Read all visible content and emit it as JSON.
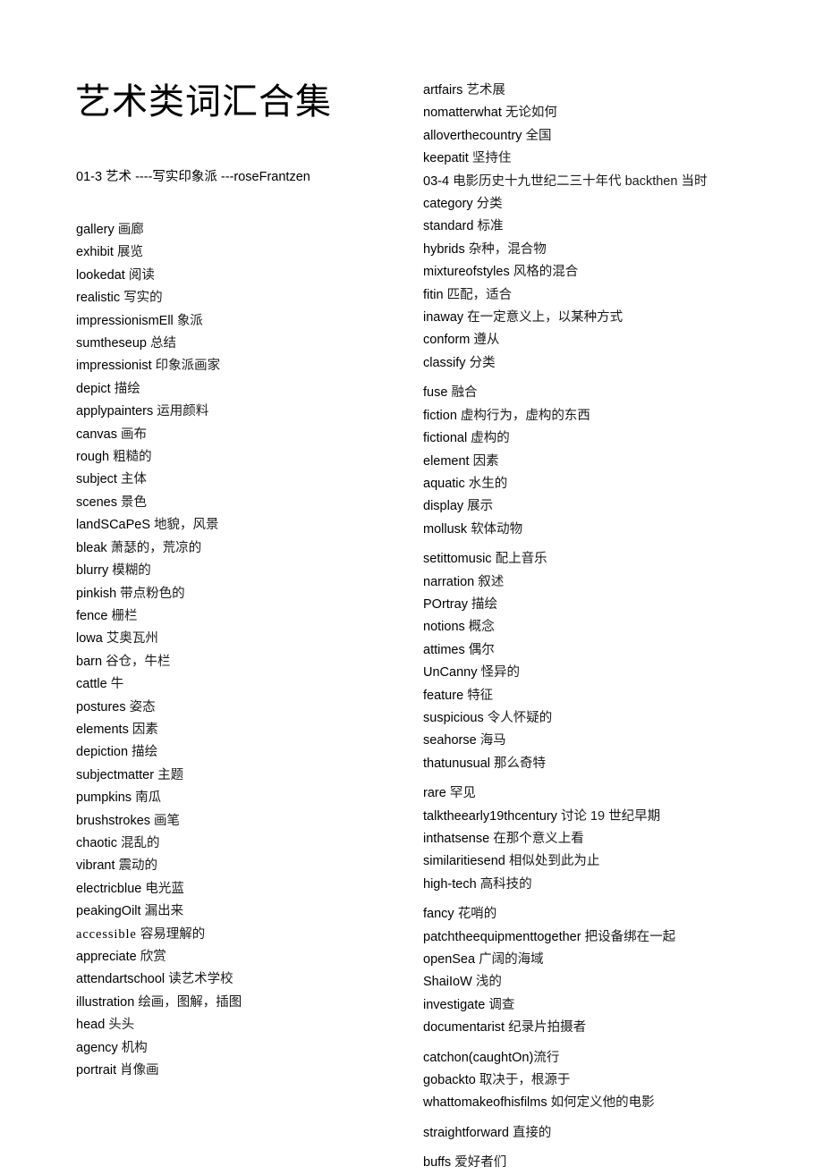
{
  "document": {
    "title": "艺术类词汇合集",
    "subtitle": "01-3 艺术 ----写实印象派 ---roseFrantzen",
    "page_background": "#ffffff",
    "text_color": "#000000"
  },
  "columns": {
    "left": {
      "entries": [
        {
          "term": "gallery",
          "gloss": "画廊"
        },
        {
          "term": "exhibit",
          "gloss": "展览"
        },
        {
          "term": "lookedat",
          "gloss": "阅读"
        },
        {
          "term": "realistic",
          "gloss": "写实的"
        },
        {
          "term": "impressionismEll",
          "gloss": "象派"
        },
        {
          "term": "sumtheseup",
          "gloss": "总结"
        },
        {
          "term": "impressionist",
          "gloss": "印象派画家"
        },
        {
          "term": "depict",
          "gloss": "描绘"
        },
        {
          "term": "applypainters",
          "gloss": "运用颜料"
        },
        {
          "term": "canvas",
          "gloss": "画布"
        },
        {
          "term": "rough",
          "gloss": "粗糙的"
        },
        {
          "term": "subject",
          "gloss": "主体"
        },
        {
          "term": "scenes",
          "gloss": "景色"
        },
        {
          "term": "landSCaPeS",
          "gloss": "地貌，风景"
        },
        {
          "term": "bleak",
          "gloss": "萧瑟的，荒凉的"
        },
        {
          "term": "blurry",
          "gloss": "模糊的"
        },
        {
          "term": "pinkish",
          "gloss": "带点粉色的"
        },
        {
          "term": "fence",
          "gloss": "栅栏"
        },
        {
          "term": "lowa",
          "gloss": "艾奥瓦州"
        },
        {
          "term": "barn",
          "gloss": "谷仓，牛栏"
        },
        {
          "term": "cattle",
          "gloss": "牛"
        },
        {
          "term": "postures",
          "gloss": "姿态"
        },
        {
          "term": "elements",
          "gloss": "因素"
        },
        {
          "term": "depiction",
          "gloss": "描绘"
        },
        {
          "term": "subjectmatter",
          "gloss": "主题"
        },
        {
          "term": "pumpkins",
          "gloss": "南瓜"
        },
        {
          "term": "brushstrokes",
          "gloss": "画笔"
        },
        {
          "term": "chaotic",
          "gloss": "混乱的"
        },
        {
          "term": "vibrant",
          "gloss": "震动的"
        },
        {
          "term": "electricblue",
          "gloss": "电光蓝"
        },
        {
          "term": "peakingOilt",
          "gloss": "漏出来"
        },
        {
          "term": "accessible",
          "gloss": "容易理解的",
          "face": "serif"
        },
        {
          "term": "appreciate",
          "gloss": "欣赏"
        },
        {
          "term": "attendartschool",
          "gloss": "读艺术学校"
        },
        {
          "term": "illustration",
          "gloss": "绘画，图解，插图"
        },
        {
          "term": "head",
          "gloss": "头头"
        },
        {
          "term": "agency",
          "gloss": "机构"
        },
        {
          "term": "portrait",
          "gloss": "肖像画"
        }
      ]
    },
    "right": {
      "entries": [
        {
          "term": "artfairs",
          "gloss": "艺术展"
        },
        {
          "term": "nomatterwhat",
          "gloss": "无论如何"
        },
        {
          "term": "alloverthecountry",
          "gloss": "全国"
        },
        {
          "term": "keepatit",
          "gloss": "坚持住"
        },
        {
          "term": "03-4",
          "gloss": "电影历史十九世纪二三十年代 backthen 当时"
        },
        {
          "term": "category",
          "gloss": "分类"
        },
        {
          "term": "standard",
          "gloss": "标准"
        },
        {
          "term": "hybrids",
          "gloss": "杂种，混合物"
        },
        {
          "term": "mixtureofstyles",
          "gloss": "风格的混合"
        },
        {
          "term": "fitin",
          "gloss": "匹配，适合"
        },
        {
          "term": "inaway",
          "gloss": "在一定意义上，以某种方式"
        },
        {
          "term": "conform",
          "gloss": "遵从"
        },
        {
          "term": "classify",
          "gloss": "分类"
        },
        {
          "term": "fuse",
          "gloss": "融合",
          "gap_before": true
        },
        {
          "term": "fiction",
          "gloss": "虚构行为，虚构的东西"
        },
        {
          "term": "fictional",
          "gloss": "虚构的"
        },
        {
          "term": "element",
          "gloss": "因素"
        },
        {
          "term": "aquatic",
          "gloss": "水生的"
        },
        {
          "term": "display",
          "gloss": "展示"
        },
        {
          "term": "mollusk",
          "gloss": "软体动物"
        },
        {
          "term": "setittomusic",
          "gloss": "配上音乐",
          "gap_before": true
        },
        {
          "term": "narration",
          "gloss": "叙述"
        },
        {
          "term": "POrtray",
          "gloss": "描绘"
        },
        {
          "term": "notions",
          "gloss": "概念"
        },
        {
          "term": "attimes",
          "gloss": "偶尔"
        },
        {
          "term": "UnCanny",
          "gloss": "怪异的"
        },
        {
          "term": "feature",
          "gloss": "特征"
        },
        {
          "term": "suspicious",
          "gloss": "令人怀疑的"
        },
        {
          "term": "seahorse",
          "gloss": "海马"
        },
        {
          "term": "thatunusual",
          "gloss": "那么奇特"
        },
        {
          "term": "rare",
          "gloss": "罕见",
          "gap_before": true
        },
        {
          "term": "talktheearly19thcentury",
          "gloss": "讨论 19 世纪早期"
        },
        {
          "term": "inthatsense",
          "gloss": "在那个意义上看"
        },
        {
          "term": "similaritiesend",
          "gloss": "相似处到此为止"
        },
        {
          "term": "high-tech",
          "gloss": "高科技的"
        },
        {
          "term": "fancy",
          "gloss": "花哨的",
          "gap_before": true
        },
        {
          "term": "patchtheequipmenttogether",
          "gloss": "把设备绑在一起"
        },
        {
          "term": "openSea",
          "gloss": "广阔的海域"
        },
        {
          "term": "ShaiIoW",
          "gloss": "浅的"
        },
        {
          "term": "investigate",
          "gloss": "调查"
        },
        {
          "term": "documentarist",
          "gloss": "纪录片拍摄者"
        },
        {
          "term": "catchon(caughtOn)",
          "gloss": "流行",
          "gap_before": true,
          "no_space": true
        },
        {
          "term": "gobackto",
          "gloss": "取决于，根源于"
        },
        {
          "term": "whattomakeofhisfilms",
          "gloss": "如何定义他的电影"
        },
        {
          "term": "straightforward",
          "gloss": "直接的",
          "gap_before": true
        },
        {
          "term": "buffs",
          "gloss": "爱好者们",
          "gap_before": true
        }
      ]
    }
  }
}
